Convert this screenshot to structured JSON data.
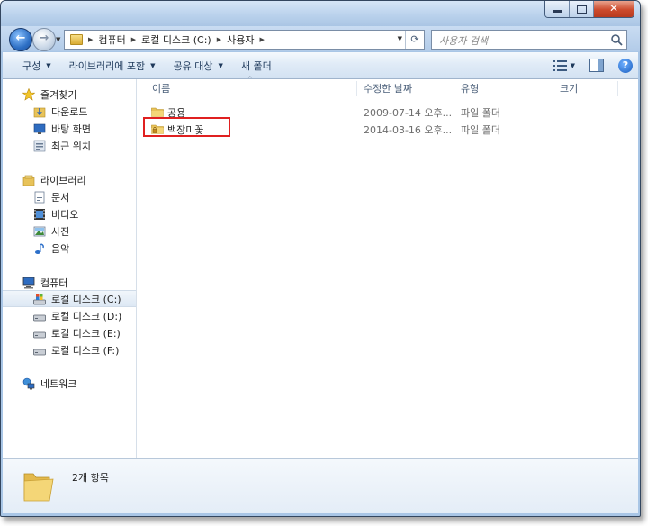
{
  "navigation": {
    "breadcrumbs": [
      "컴퓨터",
      "로컬 디스크 (C:)",
      "사용자"
    ]
  },
  "search": {
    "placeholder": "사용자 검색"
  },
  "toolbar": {
    "organize": "구성",
    "include_library": "라이브러리에 포함",
    "share_with": "공유 대상",
    "new_folder": "새 폴더"
  },
  "sidebar": {
    "favorites": {
      "label": "즐겨찾기",
      "items": [
        {
          "label": "다운로드",
          "icon": "download-folder-icon"
        },
        {
          "label": "바탕 화면",
          "icon": "desktop-icon"
        },
        {
          "label": "최근 위치",
          "icon": "recent-places-icon"
        }
      ]
    },
    "libraries": {
      "label": "라이브러리",
      "items": [
        {
          "label": "문서",
          "icon": "documents-icon"
        },
        {
          "label": "비디오",
          "icon": "video-icon"
        },
        {
          "label": "사진",
          "icon": "pictures-icon"
        },
        {
          "label": "음악",
          "icon": "music-icon"
        }
      ]
    },
    "computer": {
      "label": "컴퓨터",
      "items": [
        {
          "label": "로컬 디스크 (C:)",
          "icon": "system-drive-icon",
          "selected": true
        },
        {
          "label": "로컬 디스크 (D:)",
          "icon": "drive-icon"
        },
        {
          "label": "로컬 디스크 (E:)",
          "icon": "drive-icon"
        },
        {
          "label": "로컬 디스크 (F:)",
          "icon": "drive-icon"
        }
      ]
    },
    "network": {
      "label": "네트워크"
    }
  },
  "columns": {
    "name": "이름",
    "date_modified": "수정한 날짜",
    "type": "유형",
    "size": "크기"
  },
  "files": [
    {
      "name": "공용",
      "date": "2009-07-14 오후...",
      "type": "파일 폴더",
      "icon": "folder-icon"
    },
    {
      "name": "백장미꽃",
      "date": "2014-03-16 오후...",
      "type": "파일 폴더",
      "icon": "locked-folder-icon",
      "highlighted": true
    }
  ],
  "details": {
    "item_count": "2개 항목"
  },
  "colors": {
    "highlight": "#e02020",
    "window_frame": "#a9c6e6",
    "folder": "#e8c35a"
  }
}
